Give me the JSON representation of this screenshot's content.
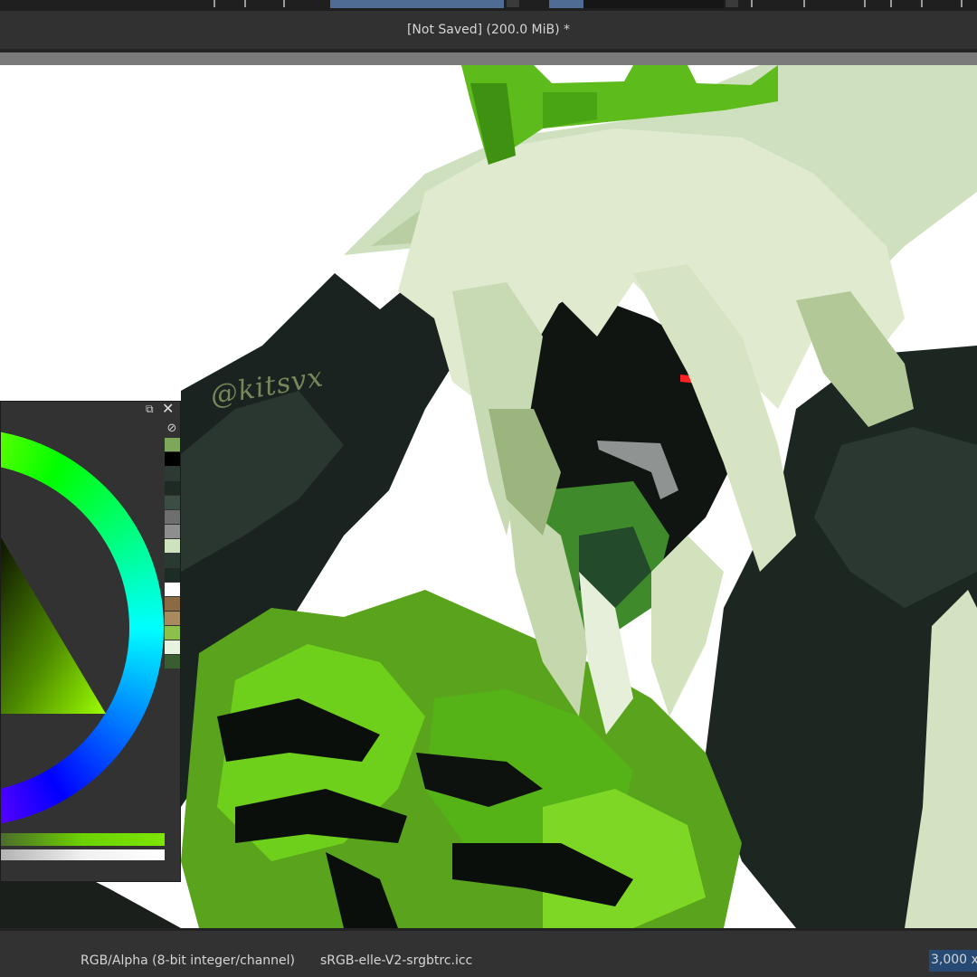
{
  "window": {
    "title": "[Not Saved]  (200.0 MiB) *"
  },
  "canvas": {
    "watermark": "@kitsvx"
  },
  "color_docker": {
    "float_icon": "float-icon",
    "close_icon": "close-icon",
    "clear_icon": "clear-history-icon",
    "swatches": [
      "#7ea75a",
      "#000000",
      "#2d3a33",
      "#1e2a24",
      "#3c4d43",
      "#6e6e6e",
      "#8e8e8e",
      "#cfe2c0",
      "#293a30",
      "#1d2d25",
      "#ffffff",
      "#8b6b43",
      "#a88a5f",
      "#8cc04a",
      "#e8f3df",
      "#395c30"
    ]
  },
  "statusbar": {
    "color_model": "RGB/Alpha (8-bit integer/channel)",
    "profile": "sRGB-elle-V2-srgbtrc.icc",
    "size": "3,000 x"
  }
}
